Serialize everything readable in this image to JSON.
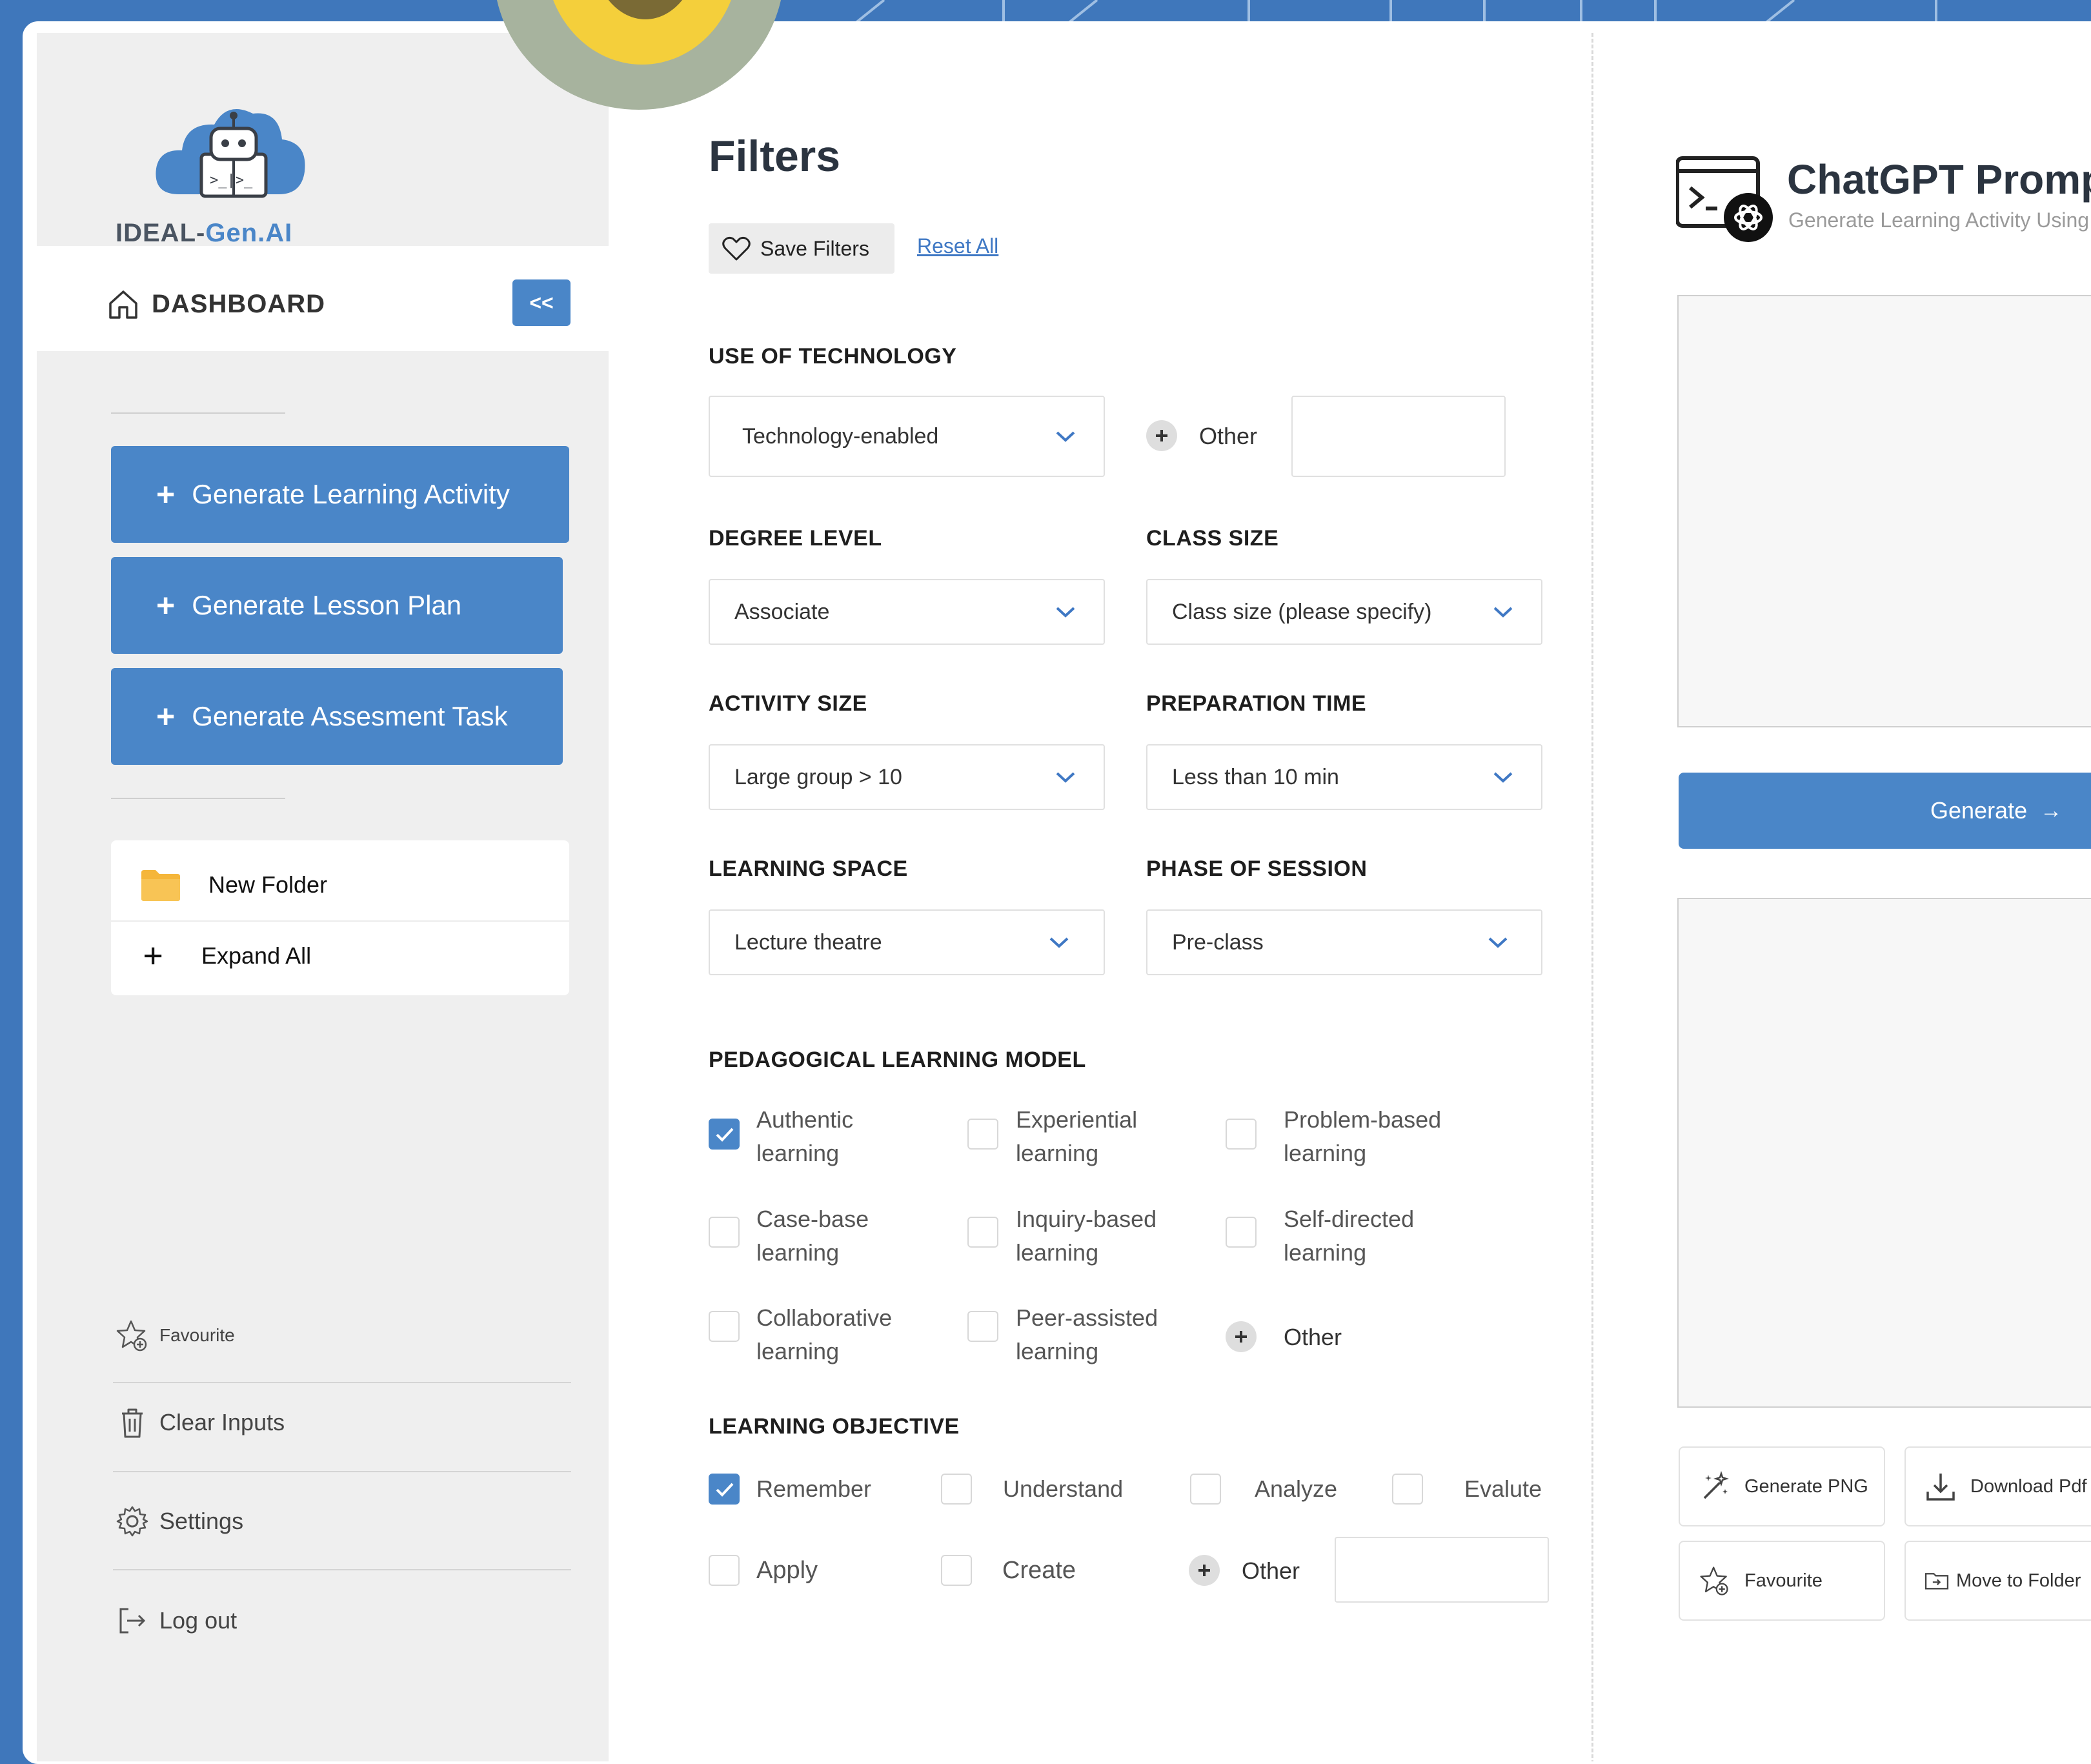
{
  "colors": {
    "accent": "#4a86c8",
    "background": "#3f77bb",
    "sidebar": "#efefef",
    "link": "#3f78c4"
  },
  "logo": {
    "part1": "IDEAL-",
    "part2": "Gen.AI",
    "icon": "robot-cloud-logo"
  },
  "sidebar": {
    "dashboard_label": "DASHBOARD",
    "collapse_label": "<<",
    "generate_buttons": [
      {
        "label": "Generate Learning Activity"
      },
      {
        "label": "Generate Lesson Plan"
      },
      {
        "label": "Generate Assesment Task"
      }
    ],
    "folder_items": [
      {
        "label": "New Folder",
        "icon": "folder-icon"
      },
      {
        "label": "Expand All",
        "icon": "plus-icon"
      }
    ],
    "bottom_links": [
      {
        "label": "Favourite",
        "icon": "star-add-icon"
      },
      {
        "label": "Clear Inputs",
        "icon": "trash-icon"
      },
      {
        "label": "Settings",
        "icon": "gear-icon"
      },
      {
        "label": "Log out",
        "icon": "logout-icon"
      }
    ]
  },
  "filters": {
    "title": "Filters",
    "save_label": "Save Filters",
    "reset_label": "Reset All",
    "use_of_technology": {
      "label": "USE OF TECHNOLOGY",
      "value": "Technology-enabled",
      "other_label": "Other",
      "other_value": ""
    },
    "degree_level": {
      "label": "DEGREE LEVEL",
      "value": "Associate"
    },
    "class_size": {
      "label": "CLASS SIZE",
      "value": "Class size (please specify)"
    },
    "activity_size": {
      "label": "ACTIVITY SIZE",
      "value": "Large group > 10"
    },
    "preparation_time": {
      "label": "PREPARATION TIME",
      "value": "Less than 10 min"
    },
    "learning_space": {
      "label": "LEARNING SPACE",
      "value": "Lecture theatre"
    },
    "phase_of_session": {
      "label": "PHASE OF SESSION",
      "value": "Pre-class"
    },
    "pedagogical_model": {
      "label": "PEDAGOGICAL LEARNING MODEL",
      "options": [
        {
          "line1": "Authentic",
          "line2": "learning",
          "checked": true
        },
        {
          "line1": "Experiential",
          "line2": "learning",
          "checked": false
        },
        {
          "line1": "Problem-based",
          "line2": "learning",
          "checked": false
        },
        {
          "line1": "Case-base",
          "line2": "learning",
          "checked": false
        },
        {
          "line1": "Inquiry-based",
          "line2": "learning",
          "checked": false
        },
        {
          "line1": "Self-directed",
          "line2": "learning",
          "checked": false
        },
        {
          "line1": "Collaborative",
          "line2": "learning",
          "checked": false
        },
        {
          "line1": "Peer-assisted",
          "line2": "learning",
          "checked": false
        }
      ],
      "other_label": "Other"
    },
    "learning_objective": {
      "label": "LEARNING OBJECTIVE",
      "options": [
        {
          "label": "Remember",
          "checked": true
        },
        {
          "label": "Understand",
          "checked": false
        },
        {
          "label": "Analyze",
          "checked": false
        },
        {
          "label": "Evalute",
          "checked": false
        },
        {
          "label": "Apply",
          "checked": false
        },
        {
          "label": "Create",
          "checked": false
        }
      ],
      "other_label": "Other",
      "other_value": ""
    }
  },
  "chatgpt": {
    "title": "ChatGPT Prompt",
    "subtitle": "Generate Learning Activity Using",
    "icon": "terminal-openai-icon",
    "prompt_value": "",
    "output_value": "",
    "generate_label": "Generate",
    "generate_arrow": "→",
    "actions": [
      {
        "label": "Generate PNG",
        "icon": "magic-wand-icon"
      },
      {
        "label": "Download Pdf",
        "icon": "download-icon"
      },
      {
        "label": "Favourite",
        "icon": "star-add-icon"
      },
      {
        "label": "Move to Folder",
        "icon": "folder-move-icon"
      }
    ]
  }
}
